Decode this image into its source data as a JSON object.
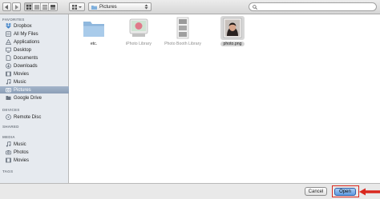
{
  "toolbar": {
    "view_modes": [
      "icon-view",
      "list-view",
      "column-view",
      "coverflow-view"
    ],
    "arrange_icon": "arrange-icon",
    "path_label": "Pictures",
    "search_placeholder": ""
  },
  "sidebar": {
    "favorites_title": "FAVORITES",
    "favorites": [
      {
        "label": "Dropbox",
        "icon": "dropbox-icon"
      },
      {
        "label": "All My Files",
        "icon": "all-files-icon"
      },
      {
        "label": "Applications",
        "icon": "applications-icon"
      },
      {
        "label": "Desktop",
        "icon": "desktop-icon"
      },
      {
        "label": "Documents",
        "icon": "documents-icon"
      },
      {
        "label": "Downloads",
        "icon": "downloads-icon"
      },
      {
        "label": "Movies",
        "icon": "movies-icon"
      },
      {
        "label": "Music",
        "icon": "music-icon"
      },
      {
        "label": "Pictures",
        "icon": "pictures-icon",
        "selected": true
      },
      {
        "label": "Google Drive",
        "icon": "google-drive-icon"
      }
    ],
    "devices_title": "DEVICES",
    "devices": [
      {
        "label": "Remote Disc",
        "icon": "disc-icon"
      }
    ],
    "shared_title": "SHARED",
    "media_title": "MEDIA",
    "media": [
      {
        "label": "Music",
        "icon": "music-icon"
      },
      {
        "label": "Photos",
        "icon": "camera-icon"
      },
      {
        "label": "Movies",
        "icon": "film-icon"
      }
    ],
    "tags_title": "TAGS"
  },
  "files": [
    {
      "name": "etc.",
      "icon": "folder-icon",
      "dim": false,
      "selected": false
    },
    {
      "name": "iPhoto Library",
      "icon": "iphoto-library-icon",
      "dim": true,
      "selected": false
    },
    {
      "name": "Photo Booth Library",
      "icon": "photo-booth-library-icon",
      "dim": true,
      "selected": false
    },
    {
      "name": "photo.png",
      "icon": "photo-thumbnail",
      "dim": false,
      "selected": true
    }
  ],
  "buttons": {
    "cancel": "Cancel",
    "open": "Open"
  },
  "colors": {
    "sidebar_bg": "#e6eaef",
    "selection": "#8c9fb7",
    "highlight_box": "#d9281f",
    "open_button": "#5f9ae0"
  }
}
